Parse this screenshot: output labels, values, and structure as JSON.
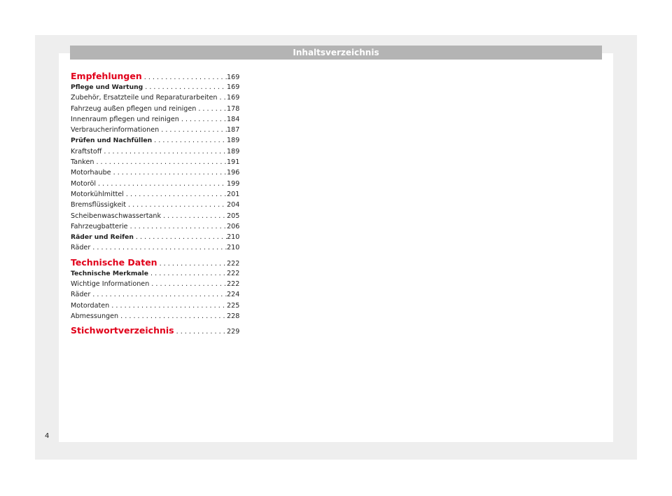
{
  "header": {
    "title": "Inhaltsverzeichnis"
  },
  "toc": [
    {
      "label": "Empfehlungen",
      "page": "169",
      "kind": "chapter"
    },
    {
      "label": "Pflege und Wartung",
      "page": "169",
      "kind": "section"
    },
    {
      "label": "Zubehör, Ersatzteile und Reparaturarbeiten",
      "page": "169",
      "kind": "entry"
    },
    {
      "label": "Fahrzeug außen pflegen und reinigen",
      "page": "178",
      "kind": "entry"
    },
    {
      "label": "Innenraum pflegen und reinigen",
      "page": "184",
      "kind": "entry"
    },
    {
      "label": "Verbraucherinformationen",
      "page": "187",
      "kind": "entry"
    },
    {
      "label": "Prüfen und Nachfüllen",
      "page": "189",
      "kind": "section"
    },
    {
      "label": "Kraftstoff",
      "page": "189",
      "kind": "entry"
    },
    {
      "label": "Tanken",
      "page": "191",
      "kind": "entry"
    },
    {
      "label": "Motorhaube",
      "page": "196",
      "kind": "entry"
    },
    {
      "label": "Motoröl",
      "page": "199",
      "kind": "entry"
    },
    {
      "label": "Motorkühlmittel",
      "page": "201",
      "kind": "entry"
    },
    {
      "label": "Bremsflüssigkeit",
      "page": "204",
      "kind": "entry"
    },
    {
      "label": "Scheibenwaschwassertank",
      "page": "205",
      "kind": "entry"
    },
    {
      "label": "Fahrzeugbatterie",
      "page": "206",
      "kind": "entry"
    },
    {
      "label": "Räder und Reifen",
      "page": "210",
      "kind": "section"
    },
    {
      "label": "Räder",
      "page": "210",
      "kind": "entry"
    },
    {
      "label": "Technische Daten",
      "page": "222",
      "kind": "chapter"
    },
    {
      "label": "Technische Merkmale",
      "page": "222",
      "kind": "section"
    },
    {
      "label": "Wichtige Informationen",
      "page": "222",
      "kind": "entry"
    },
    {
      "label": "Räder",
      "page": "224",
      "kind": "entry"
    },
    {
      "label": "Motordaten",
      "page": "225",
      "kind": "entry"
    },
    {
      "label": "Abmessungen",
      "page": "228",
      "kind": "entry"
    },
    {
      "label": "Stichwortverzeichnis",
      "page": "229",
      "kind": "chapter"
    }
  ],
  "footer": {
    "page_number": "4"
  },
  "colors": {
    "chapter_accent": "#e1001a",
    "header_bar": "#b4b4b4",
    "frame_background": "#eeeeee"
  }
}
